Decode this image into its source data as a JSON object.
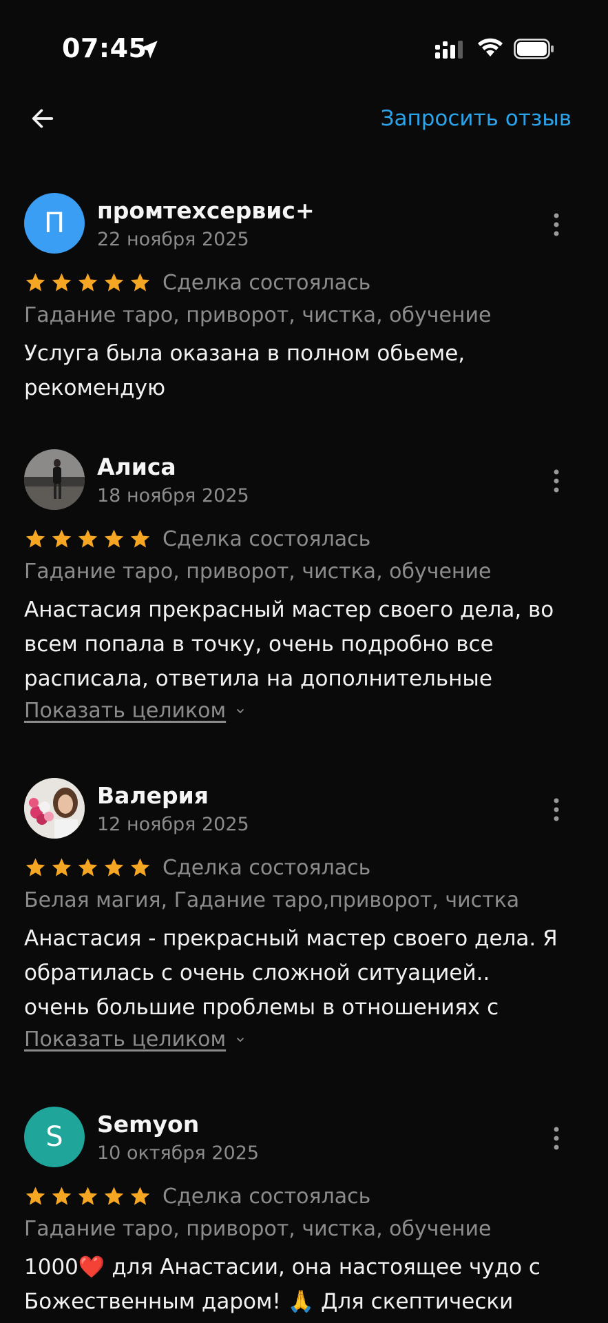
{
  "status_bar": {
    "time": "07:45"
  },
  "header": {
    "request_review": "Запросить отзыв"
  },
  "colors": {
    "accent": "#2aa3e8",
    "star": "#f5a623",
    "avatar_p": "#3a9ef5",
    "avatar_s": "#1fa59a"
  },
  "reviews": [
    {
      "avatar_letter": "П",
      "author": "промтехсервис+",
      "date": "22 ноября 2025",
      "rating": 5,
      "status": "Сделка состоялась",
      "services": "Гадание таро, приворот, чистка, обучение",
      "text": "Услуга была оказана в полном обьеме, рекомендую"
    },
    {
      "avatar_letter": "",
      "author": "Алиса",
      "date": "18 ноября 2025",
      "rating": 5,
      "status": "Сделка состоялась",
      "services": "Гадание таро, приворот, чистка, обучение",
      "text": "Анастасия прекрасный мастер своего дела, во всем попала в точку, очень подробно все расписала,  ответила на дополнительные",
      "show_more": "Показать целиком"
    },
    {
      "avatar_letter": "",
      "author": "Валерия",
      "date": "12 ноября 2025",
      "rating": 5,
      "status": "Сделка состоялась",
      "services": "Белая магия, Гадание таро,приворот, чистка",
      "text": "Анастасия - прекрасный мастер своего дела. Я обратилась с очень сложной ситуацией.. очень большие проблемы в отношениях с любимым",
      "show_more": "Показать целиком"
    },
    {
      "avatar_letter": "S",
      "author": "Semyon",
      "date": "10 октября 2025",
      "rating": 5,
      "status": "Сделка состоялась",
      "services": "Гадание таро, приворот, чистка, обучение",
      "text_part1": "1000",
      "text_heart": "❤️",
      "text_part2": " для Анастасии, она настоящее чудо с Божественным даром! ",
      "text_hands": "🙏",
      "text_part3": " Для скептически"
    }
  ]
}
